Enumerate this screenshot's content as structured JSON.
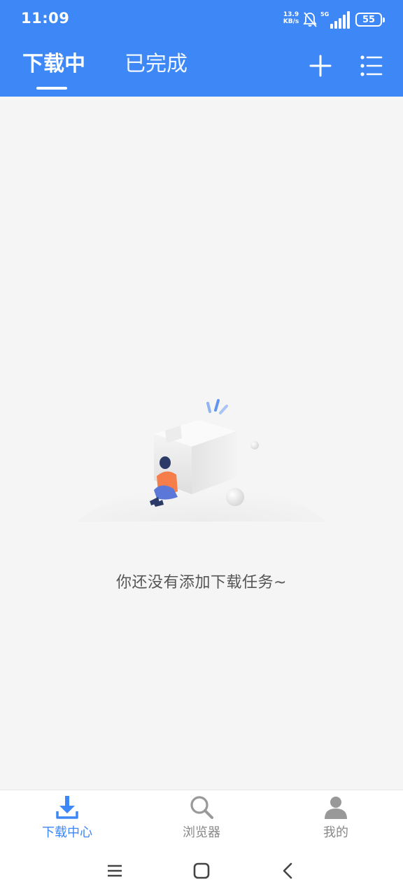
{
  "status_bar": {
    "time": "11:09",
    "net_speed_value": "13.9",
    "net_speed_unit": "KB/s",
    "network_type": "5G",
    "battery_level": "55"
  },
  "header": {
    "tabs": [
      {
        "label": "下载中",
        "active": true
      },
      {
        "label": "已完成",
        "active": false
      }
    ],
    "icons": [
      "add-icon",
      "list-menu-icon"
    ],
    "background_color": "#3d87f6"
  },
  "empty_state": {
    "message": "你还没有添加下载任务~"
  },
  "bottom_nav": {
    "items": [
      {
        "label": "下载中心",
        "icon": "download-icon",
        "active": true
      },
      {
        "label": "浏览器",
        "icon": "search-icon",
        "active": false
      },
      {
        "label": "我的",
        "icon": "user-icon",
        "active": false
      }
    ],
    "active_color": "#3d87f6"
  },
  "system_nav": {
    "icons": [
      "recents-icon",
      "home-icon",
      "back-icon"
    ]
  }
}
